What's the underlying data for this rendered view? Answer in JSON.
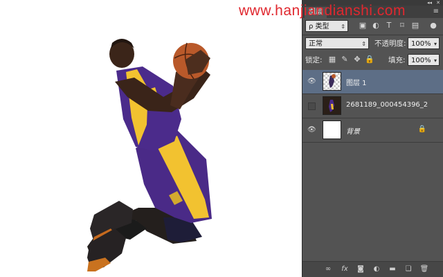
{
  "watermark": "www.hanjiandianshi.com",
  "panel": {
    "tab_label": "图层",
    "tab_menu": "≡",
    "top_controls": [
      "◂◂",
      "✕"
    ],
    "filter": {
      "label": "ρ 类型",
      "icons": [
        "image-filter-icon",
        "adjustment-filter-icon",
        "type-filter-icon",
        "shape-filter-icon",
        "smart-object-filter-icon",
        "filter-toggle-icon"
      ]
    },
    "blend_mode": "正常",
    "opacity_label": "不透明度:",
    "opacity_value": "100%",
    "lock_label": "锁定:",
    "lock_icons": [
      "lock-transparent-icon",
      "lock-image-icon",
      "lock-position-icon",
      "lock-all-icon"
    ],
    "fill_label": "填充:",
    "fill_value": "100%",
    "layers": [
      {
        "name": "图层 1",
        "selected": true,
        "visible": true,
        "thumb": "checker",
        "locked": false
      },
      {
        "name": "2681189_000454396_2",
        "selected": false,
        "visible": false,
        "thumb": "dark",
        "locked": false
      },
      {
        "name": "背景",
        "selected": false,
        "visible": true,
        "thumb": "white",
        "locked": true
      }
    ],
    "bottom_icons": [
      "link-layers-icon",
      "fx-icon",
      "add-mask-icon",
      "adjustment-layer-icon",
      "new-group-icon",
      "new-layer-icon",
      "delete-layer-icon"
    ]
  },
  "colors": {
    "panel_bg": "#535353",
    "selected_layer": "#5d6e86",
    "watermark": "#e0282f"
  }
}
